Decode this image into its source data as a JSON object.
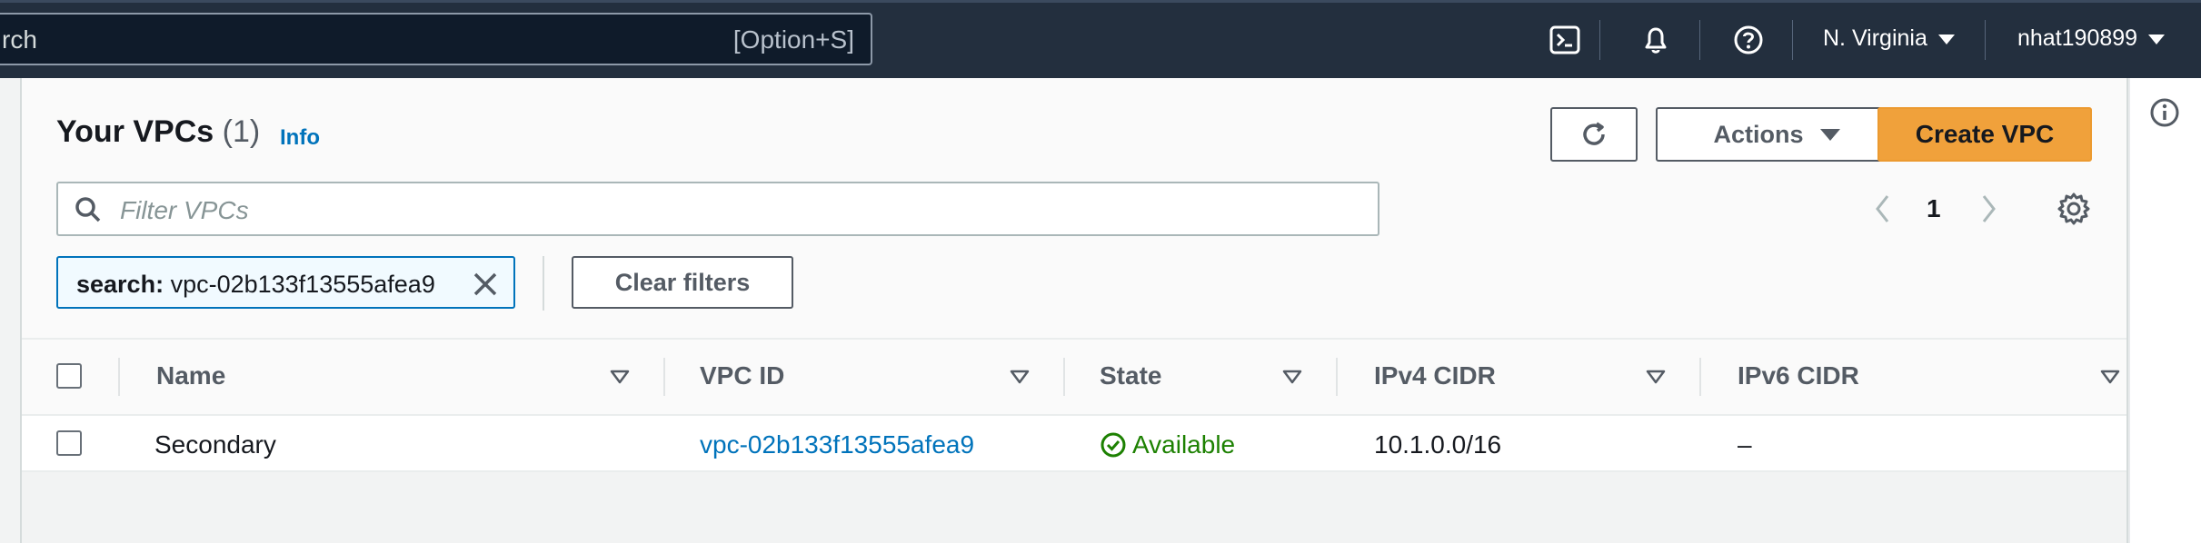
{
  "topbar": {
    "search_text": "rch",
    "search_shortcut": "[Option+S]",
    "region": "N. Virginia",
    "user": "nhat190899",
    "icons": [
      "cloudshell-icon",
      "bell-icon",
      "help-icon"
    ]
  },
  "panel": {
    "title": "Your VPCs",
    "count": "(1)",
    "info_label": "Info",
    "refresh_icon": "refresh-icon",
    "actions_label": "Actions",
    "create_label": "Create VPC",
    "filter_placeholder": "Filter VPCs",
    "page_number": "1",
    "token_key": "search:",
    "token_value": "vpc-02b133f13555afea9",
    "clear_filters_label": "Clear filters"
  },
  "table": {
    "columns": [
      "Name",
      "VPC ID",
      "State",
      "IPv4 CIDR",
      "IPv6 CIDR"
    ],
    "rows": [
      {
        "name": "Secondary",
        "vpc_id": "vpc-02b133f13555afea9",
        "state": "Available",
        "ipv4_cidr": "10.1.0.0/16",
        "ipv6_cidr": "–"
      }
    ]
  },
  "colors": {
    "topbar": "#232f3e",
    "primary_button": "#f0a13b",
    "link": "#0073bb",
    "success": "#1d8102"
  }
}
